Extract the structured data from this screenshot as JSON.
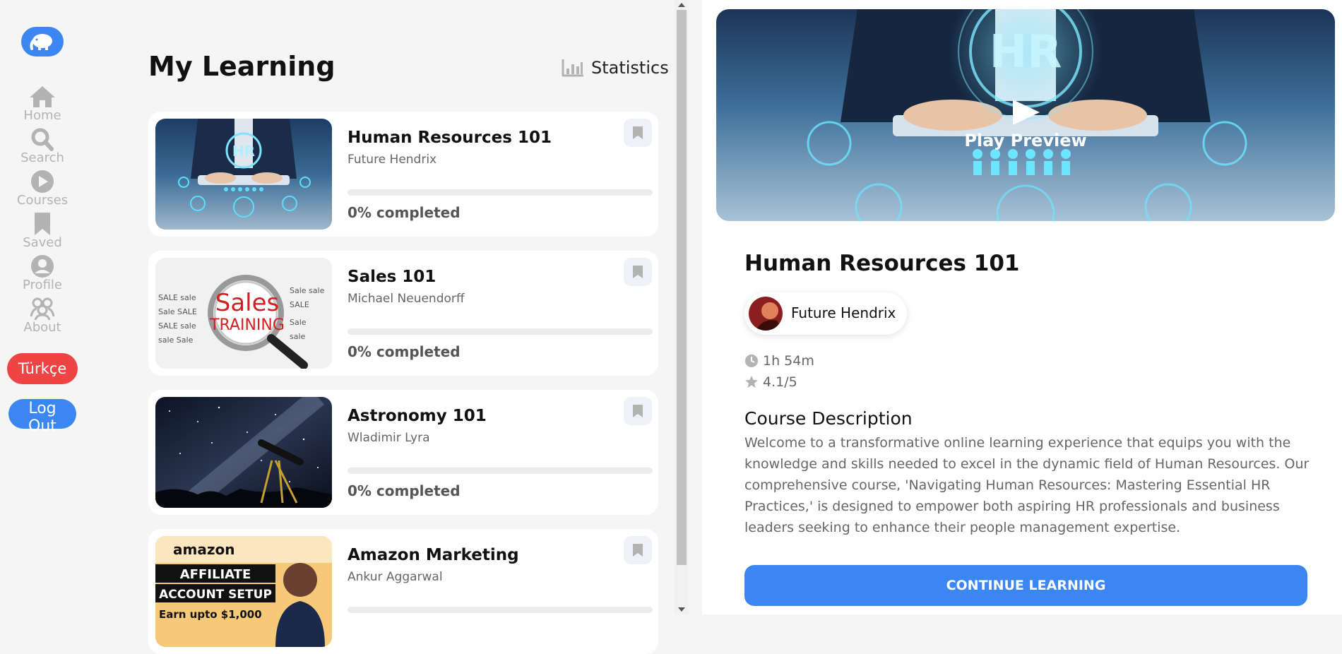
{
  "sidebar": {
    "logo_icon": "elephant-icon",
    "items": [
      {
        "label": "Home",
        "icon": "home-icon"
      },
      {
        "label": "Search",
        "icon": "search-icon"
      },
      {
        "label": "Courses",
        "icon": "play-circle-icon"
      },
      {
        "label": "Saved",
        "icon": "bookmark-icon"
      },
      {
        "label": "Profile",
        "icon": "user-circle-icon"
      },
      {
        "label": "About",
        "icon": "users-icon"
      }
    ],
    "language_button": "Türkçe",
    "logout_button": "Log Out"
  },
  "main": {
    "title": "My Learning",
    "statistics_label": "Statistics",
    "courses": [
      {
        "title": "Human Resources 101",
        "author": "Future Hendrix",
        "progress_text": "0% completed",
        "progress": 0,
        "thumb_text": "HR"
      },
      {
        "title": "Sales 101",
        "author": "Michael Neuendorff",
        "progress_text": "0% completed",
        "progress": 0,
        "thumb_text": "Sales",
        "thumb_text_2": "TRAINING"
      },
      {
        "title": "Astronomy 101",
        "author": "Wladimir Lyra",
        "progress_text": "0% completed",
        "progress": 0
      },
      {
        "title": "Amazon Marketing",
        "author": "Ankur Aggarwal",
        "progress_text": "",
        "progress": 0,
        "thumb_lines": [
          "amazon",
          "AFFILIATE",
          "ACCOUNT SETUP",
          "Earn upto $1,000"
        ]
      }
    ]
  },
  "detail": {
    "preview_label": "Play Preview",
    "preview_text": "HR",
    "title": "Human Resources 101",
    "instructor": "Future Hendrix",
    "duration": "1h 54m",
    "rating": "4.1/5",
    "description_heading": "Course Description",
    "description": "Welcome to a transformative online learning experience that equips you with the knowledge and skills needed to excel in the dynamic field of Human Resources. Our comprehensive course, 'Navigating Human Resources: Mastering Essential HR Practices,' is designed to empower both aspiring HR professionals and business leaders seeking to enhance their people management expertise.",
    "continue_button": "CONTINUE LEARNING"
  },
  "colors": {
    "accent": "#3b86f0",
    "danger": "#ef4444",
    "muted": "#b3b3b3"
  }
}
